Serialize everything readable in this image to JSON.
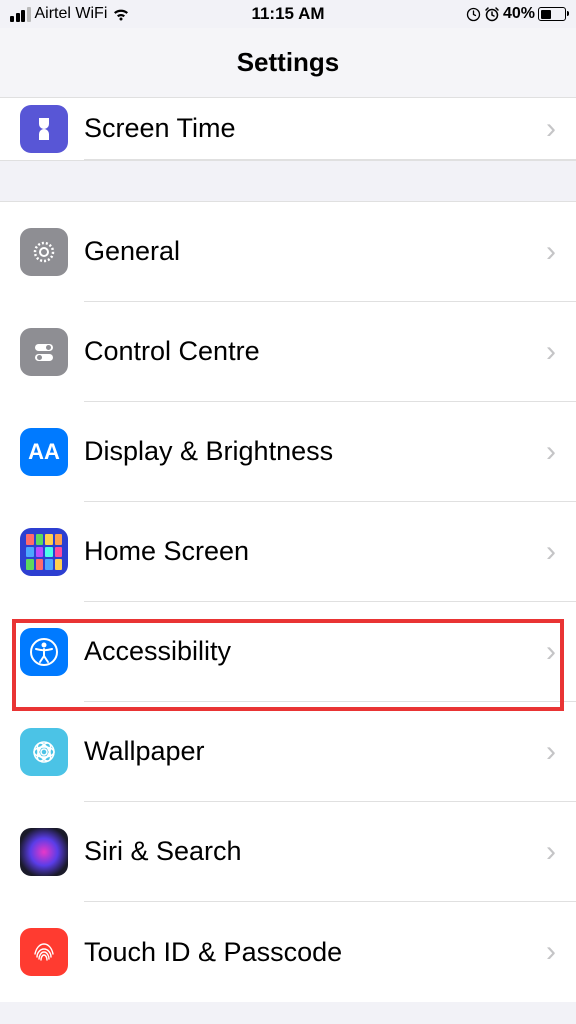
{
  "status": {
    "carrier": "Airtel WiFi",
    "time": "11:15 AM",
    "battery_pct": "40%"
  },
  "header": {
    "title": "Settings"
  },
  "section1": {
    "screen_time": "Screen Time"
  },
  "section2": {
    "general": "General",
    "control_centre": "Control Centre",
    "display_brightness": "Display & Brightness",
    "home_screen": "Home Screen",
    "accessibility": "Accessibility",
    "wallpaper": "Wallpaper",
    "siri_search": "Siri & Search",
    "touch_id": "Touch ID & Passcode"
  },
  "icons": {
    "screen_time": "#5856d6",
    "general": "#8e8e93",
    "control_centre": "#8e8e93",
    "display_brightness": "#007aff",
    "home_screen": "#3355dd",
    "accessibility": "#007aff",
    "wallpaper": "#4bc3e6",
    "siri_search": "#1a1a1a",
    "touch_id": "#ff3b30"
  }
}
